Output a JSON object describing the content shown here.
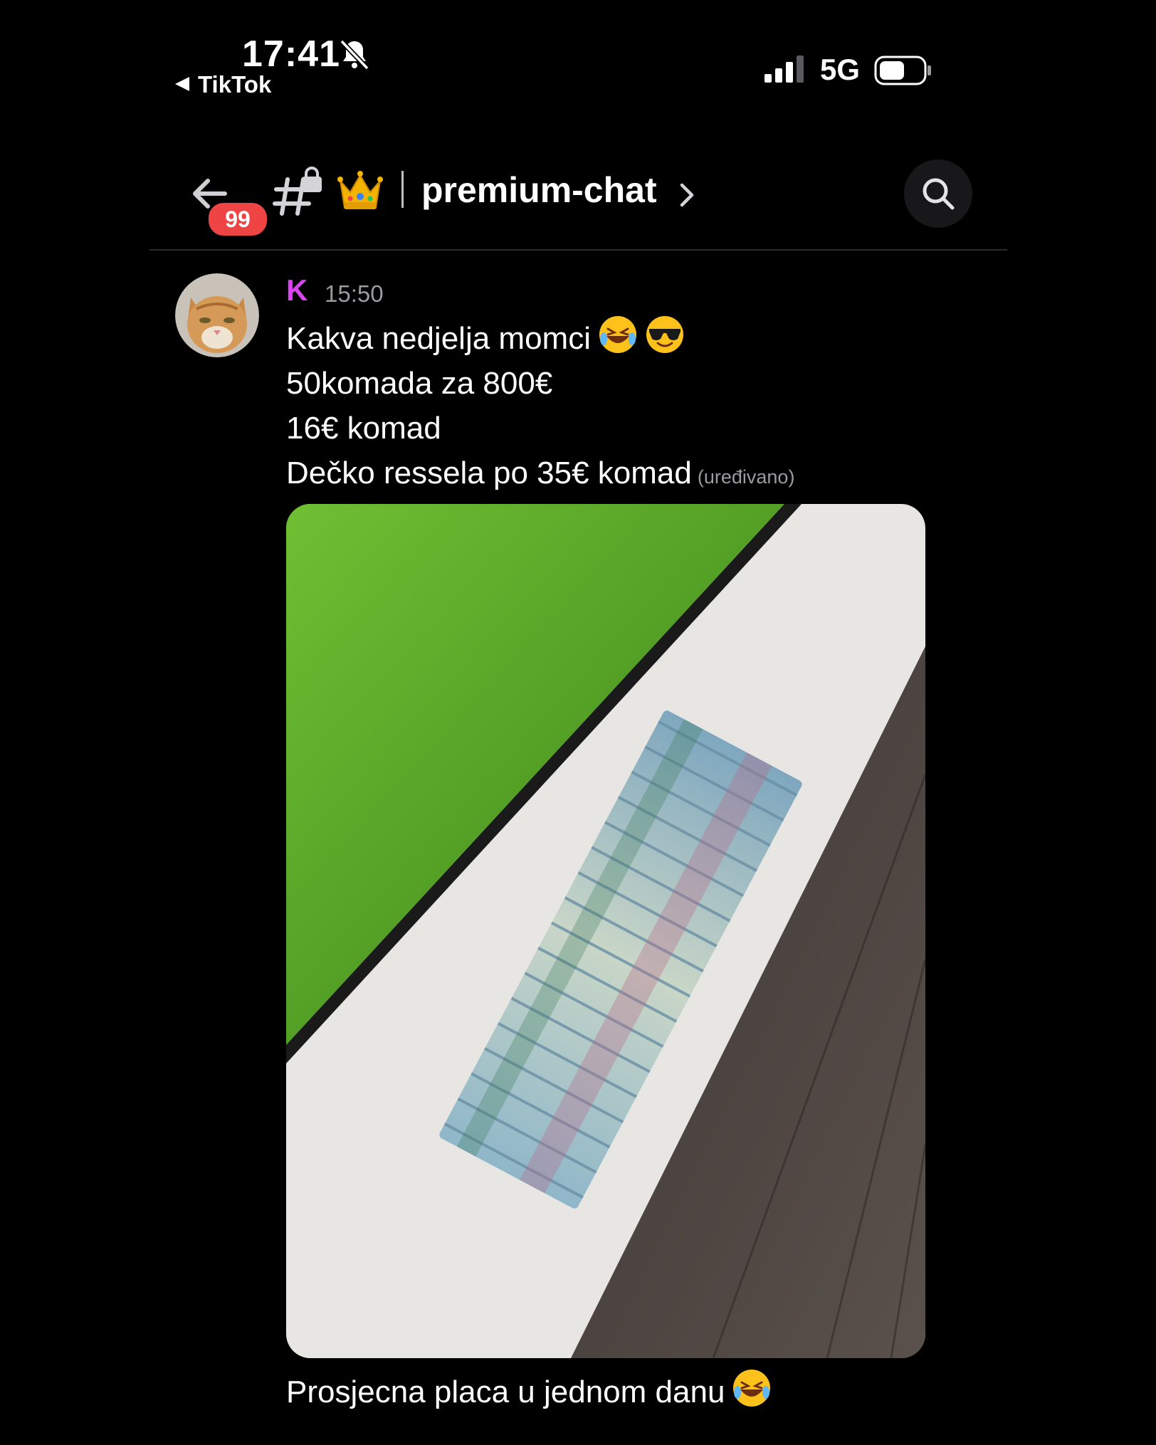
{
  "status_bar": {
    "time": "17:41",
    "back_app": "TikTok",
    "network": "5G",
    "icons": [
      "bell-off-icon",
      "signal-icon",
      "battery-icon"
    ]
  },
  "header": {
    "unread_count": "99",
    "channel_emoji": "👑",
    "channel_name": "premium-chat",
    "icons": [
      "back-arrow-icon",
      "locked-hash-icon",
      "chevron-right-icon",
      "search-icon"
    ]
  },
  "message": {
    "author": "K",
    "timestamp": "15:50",
    "author_color": "#d946ef",
    "lines": [
      "Kakva nedjelja momci",
      "50komada za 800€",
      "16€ komad",
      "Dečko ressela po 35€ komad"
    ],
    "edited_label": "(uređivano)",
    "caption": "Prosjecna placa u jednom danu"
  },
  "colors": {
    "background": "#000000",
    "badge": "#ef4444",
    "muted_text": "#9a9aa0"
  }
}
